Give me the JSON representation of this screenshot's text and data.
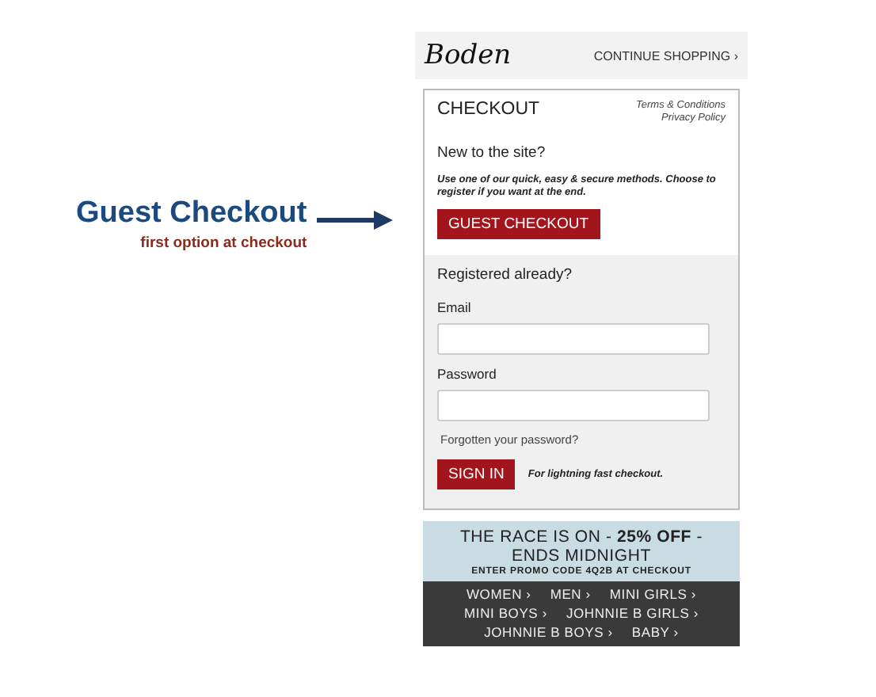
{
  "annotation": {
    "title": "Guest Checkout",
    "subtitle": "first option at checkout"
  },
  "header": {
    "logo": "Boden",
    "continue_link": "CONTINUE SHOPPING ›"
  },
  "checkout": {
    "title": "CHECKOUT",
    "links": [
      "Terms & Conditions",
      "Privacy Policy"
    ],
    "new_heading": "New to the site?",
    "new_note": "Use one of our quick, easy & secure methods. Choose to register if you want at the end.",
    "guest_button": "GUEST CHECKOUT",
    "registered_heading": "Registered already?",
    "email_label": "Email",
    "password_label": "Password",
    "forgot_link": "Forgotten your password?",
    "sign_in_button": "SIGN IN",
    "sign_in_note": "For lightning fast checkout."
  },
  "promo": {
    "headline": "THE RACE IS ON - **25% OFF** -",
    "headline_2": "ENDS MIDNIGHT",
    "code_line": "ENTER PROMO CODE 4Q2B AT CHECKOUT"
  },
  "nav": {
    "rows": [
      [
        "WOMEN ›",
        "MEN ›",
        "MINI GIRLS ›"
      ],
      [
        "MINI BOYS ›",
        "JOHNNIE B GIRLS ›"
      ],
      [
        "JOHNNIE B BOYS ›",
        "BABY ›"
      ]
    ]
  }
}
